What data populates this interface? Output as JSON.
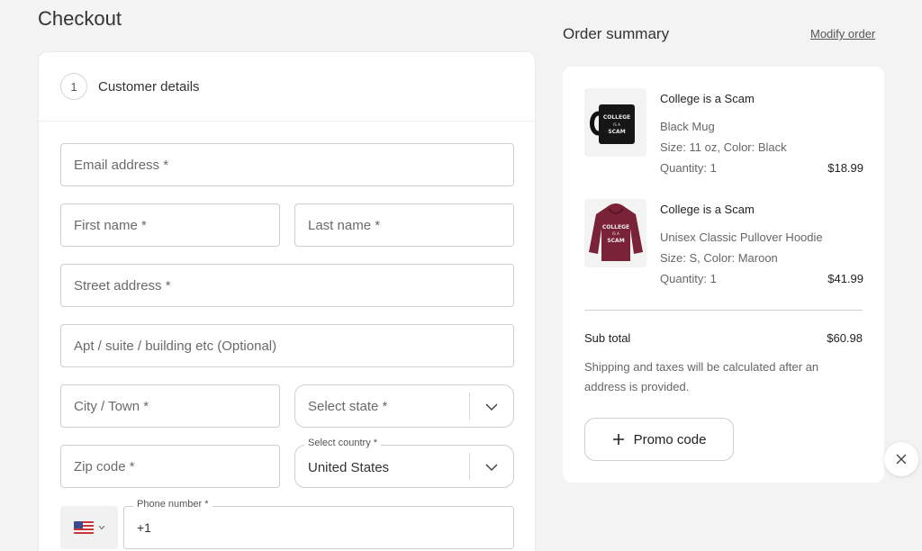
{
  "page": {
    "title": "Checkout"
  },
  "customer_details": {
    "step_number": "1",
    "step_label": "Customer details",
    "fields": {
      "email": "Email address *",
      "first_name": "First name *",
      "last_name": "Last name *",
      "street": "Street address *",
      "apt": "Apt / suite / building etc (Optional)",
      "city": "City / Town *",
      "state": "Select state *",
      "zip": "Zip code *",
      "country_label": "Select country *",
      "country_value": "United States",
      "phone_label": "Phone number *",
      "phone_value": "+1"
    },
    "phone_flag": "us-flag-icon"
  },
  "summary": {
    "title": "Order summary",
    "modify_link": "Modify order",
    "items": [
      {
        "title": "College is a Scam",
        "product": "Black Mug",
        "variant": "Size: 11 oz, Color: Black",
        "quantity": "Quantity: 1",
        "price": "$18.99",
        "print_text": [
          "COLLEGE",
          "IS A",
          "SCAM"
        ]
      },
      {
        "title": "College is a Scam",
        "product": "Unisex Classic Pullover Hoodie",
        "variant": "Size: S, Color: Maroon",
        "quantity": "Quantity: 1",
        "price": "$41.99",
        "print_text": [
          "COLLEGE",
          "IS A",
          "SCAM"
        ]
      }
    ],
    "subtotal_label": "Sub total",
    "subtotal_value": "$60.98",
    "shipping_note": "Shipping and taxes will be calculated after an address is provided.",
    "promo_label": "Promo code"
  },
  "colors": {
    "background": "#f3f3f3",
    "card": "#ffffff",
    "border": "#cfcfcf",
    "maroon": "#7a2237"
  }
}
